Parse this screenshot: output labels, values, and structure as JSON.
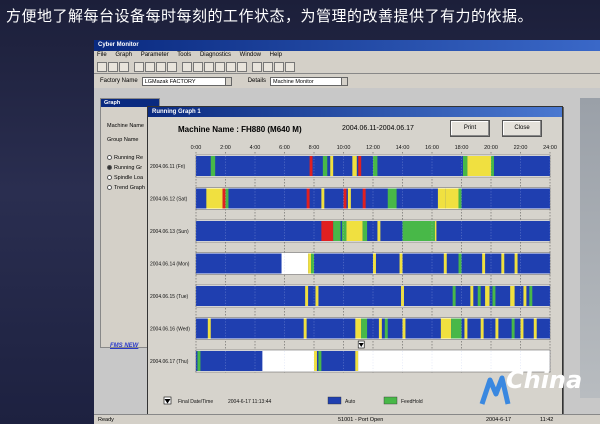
{
  "slide": {
    "title": "方便地了解每台设备每时每刻的工作状态，为管理的改善提供了有力的依据。"
  },
  "app": {
    "window_title": "Cyber Monitor",
    "menu": [
      "File",
      "Graph",
      "Parameter",
      "Tools",
      "Diagnostics",
      "Window",
      "Help"
    ],
    "factory_label": "Factory Name",
    "factory_value": "LGMazak FACTORY",
    "details_label": "Details",
    "details_value": "Machine Monitor"
  },
  "graph_panel": {
    "title": "Graph",
    "machine_name_label": "Machine Name",
    "group_name_label": "Group Name",
    "options": [
      "Running Re",
      "Running Gr",
      "Spindle Loa",
      "Trend Graph"
    ],
    "link": "FMS NEW"
  },
  "dialog": {
    "title": "Running Graph 1",
    "machine_label": "Machine Name :",
    "machine_value": "FH880 (M640 M)",
    "date_range": "2004.06.11-2004.06.17",
    "print_label": "Print",
    "close_label": "Close"
  },
  "statusbar": {
    "ready": "Ready",
    "port": "51001 - Port Open",
    "date": "2004-6-17",
    "time": "11:42"
  },
  "logo": {
    "text": "China"
  },
  "colors": {
    "auto": "#1f3fb0",
    "feedhold": "#48b848",
    "warning": "#f0e040",
    "alarm": "#e02020",
    "stop": "#ffffff",
    "row_bg": "#1f3fb0"
  },
  "chart_data": {
    "type": "gantt",
    "title": "",
    "x_ticks": [
      "0:00",
      "2:00",
      "4:00",
      "6:00",
      "8:00",
      "10:00",
      "12:00",
      "14:00",
      "16:00",
      "18:00",
      "20:00",
      "22:00",
      "24:00"
    ],
    "xlim_hours": [
      0,
      24
    ],
    "rows": [
      {
        "label": "2004.06.11 (Fri)",
        "segments": [
          {
            "start": 0,
            "end": 24,
            "state": "auto"
          },
          {
            "start": 1.0,
            "end": 1.3,
            "state": "feedhold"
          },
          {
            "start": 7.7,
            "end": 7.9,
            "state": "alarm"
          },
          {
            "start": 8.6,
            "end": 8.9,
            "state": "feedhold"
          },
          {
            "start": 9.1,
            "end": 9.3,
            "state": "warning"
          },
          {
            "start": 10.6,
            "end": 10.9,
            "state": "warning"
          },
          {
            "start": 11.0,
            "end": 11.2,
            "state": "alarm"
          },
          {
            "start": 12.0,
            "end": 12.3,
            "state": "feedhold"
          },
          {
            "start": 18.1,
            "end": 18.4,
            "state": "feedhold"
          },
          {
            "start": 18.4,
            "end": 20.0,
            "state": "warning"
          },
          {
            "start": 20.0,
            "end": 20.2,
            "state": "feedhold"
          }
        ]
      },
      {
        "label": "2004.06.12 (Sat)",
        "segments": [
          {
            "start": 0,
            "end": 24,
            "state": "auto"
          },
          {
            "start": 0.7,
            "end": 1.8,
            "state": "warning"
          },
          {
            "start": 1.8,
            "end": 2.0,
            "state": "alarm"
          },
          {
            "start": 2.0,
            "end": 2.2,
            "state": "feedhold"
          },
          {
            "start": 7.5,
            "end": 7.7,
            "state": "alarm"
          },
          {
            "start": 8.5,
            "end": 8.7,
            "state": "warning"
          },
          {
            "start": 10.0,
            "end": 10.2,
            "state": "alarm"
          },
          {
            "start": 10.3,
            "end": 10.5,
            "state": "warning"
          },
          {
            "start": 11.3,
            "end": 11.5,
            "state": "alarm"
          },
          {
            "start": 13.0,
            "end": 13.6,
            "state": "feedhold"
          },
          {
            "start": 16.4,
            "end": 16.9,
            "state": "warning"
          },
          {
            "start": 16.9,
            "end": 17.8,
            "state": "warning"
          },
          {
            "start": 17.8,
            "end": 18.0,
            "state": "feedhold"
          }
        ]
      },
      {
        "label": "2004.06.13 (Sun)",
        "segments": [
          {
            "start": 0,
            "end": 24,
            "state": "auto"
          },
          {
            "start": 8.5,
            "end": 9.3,
            "state": "alarm"
          },
          {
            "start": 9.3,
            "end": 9.8,
            "state": "feedhold"
          },
          {
            "start": 9.9,
            "end": 10.2,
            "state": "feedhold"
          },
          {
            "start": 10.2,
            "end": 11.3,
            "state": "warning"
          },
          {
            "start": 11.3,
            "end": 11.6,
            "state": "feedhold"
          },
          {
            "start": 12.3,
            "end": 12.5,
            "state": "warning"
          },
          {
            "start": 14.0,
            "end": 16.2,
            "state": "feedhold"
          },
          {
            "start": 16.2,
            "end": 16.3,
            "state": "warning"
          }
        ]
      },
      {
        "label": "2004.06.14 (Mon)",
        "segments": [
          {
            "start": 0,
            "end": 24,
            "state": "auto"
          },
          {
            "start": 5.8,
            "end": 7.6,
            "state": "stop"
          },
          {
            "start": 7.6,
            "end": 7.8,
            "state": "warning"
          },
          {
            "start": 7.8,
            "end": 8.0,
            "state": "feedhold"
          },
          {
            "start": 12.0,
            "end": 12.2,
            "state": "warning"
          },
          {
            "start": 13.8,
            "end": 14.0,
            "state": "warning"
          },
          {
            "start": 16.8,
            "end": 17.0,
            "state": "warning"
          },
          {
            "start": 17.8,
            "end": 18.0,
            "state": "feedhold"
          },
          {
            "start": 19.4,
            "end": 19.6,
            "state": "warning"
          },
          {
            "start": 20.7,
            "end": 20.9,
            "state": "warning"
          },
          {
            "start": 21.6,
            "end": 21.8,
            "state": "warning"
          }
        ]
      },
      {
        "label": "2004.06.15 (Tue)",
        "segments": [
          {
            "start": 0,
            "end": 24,
            "state": "auto"
          },
          {
            "start": 7.4,
            "end": 7.6,
            "state": "warning"
          },
          {
            "start": 8.1,
            "end": 8.3,
            "state": "warning"
          },
          {
            "start": 13.9,
            "end": 14.1,
            "state": "warning"
          },
          {
            "start": 17.4,
            "end": 17.6,
            "state": "feedhold"
          },
          {
            "start": 18.6,
            "end": 18.8,
            "state": "warning"
          },
          {
            "start": 19.1,
            "end": 19.3,
            "state": "feedhold"
          },
          {
            "start": 19.6,
            "end": 19.9,
            "state": "warning"
          },
          {
            "start": 20.1,
            "end": 20.3,
            "state": "feedhold"
          },
          {
            "start": 21.3,
            "end": 21.6,
            "state": "warning"
          },
          {
            "start": 22.2,
            "end": 22.4,
            "state": "warning"
          },
          {
            "start": 22.6,
            "end": 22.8,
            "state": "feedhold"
          }
        ]
      },
      {
        "label": "2004.06.16 (Wed)",
        "segments": [
          {
            "start": 0,
            "end": 24,
            "state": "auto"
          },
          {
            "start": 0.8,
            "end": 1.0,
            "state": "warning"
          },
          {
            "start": 7.3,
            "end": 7.5,
            "state": "warning"
          },
          {
            "start": 10.8,
            "end": 11.2,
            "state": "warning"
          },
          {
            "start": 11.2,
            "end": 11.6,
            "state": "feedhold"
          },
          {
            "start": 12.4,
            "end": 12.6,
            "state": "warning"
          },
          {
            "start": 12.8,
            "end": 13.0,
            "state": "feedhold"
          },
          {
            "start": 14.0,
            "end": 14.2,
            "state": "warning"
          },
          {
            "start": 16.6,
            "end": 17.3,
            "state": "warning"
          },
          {
            "start": 17.3,
            "end": 18.0,
            "state": "feedhold"
          },
          {
            "start": 18.2,
            "end": 18.4,
            "state": "warning"
          },
          {
            "start": 19.3,
            "end": 19.5,
            "state": "warning"
          },
          {
            "start": 20.3,
            "end": 20.5,
            "state": "warning"
          },
          {
            "start": 21.4,
            "end": 21.6,
            "state": "feedhold"
          },
          {
            "start": 22.0,
            "end": 22.2,
            "state": "warning"
          },
          {
            "start": 22.9,
            "end": 23.1,
            "state": "warning"
          }
        ]
      },
      {
        "label": "2004.06.17 (Thu)",
        "segments": [
          {
            "start": 0,
            "end": 11.0,
            "state": "auto"
          },
          {
            "start": 0.1,
            "end": 0.3,
            "state": "feedhold"
          },
          {
            "start": 4.5,
            "end": 8.0,
            "state": "stop"
          },
          {
            "start": 8.0,
            "end": 8.2,
            "state": "warning"
          },
          {
            "start": 8.3,
            "end": 8.5,
            "state": "feedhold"
          },
          {
            "start": 10.8,
            "end": 11.0,
            "state": "warning"
          },
          {
            "start": 11.0,
            "end": 11.7,
            "state": "stop"
          }
        ]
      }
    ],
    "final_marker_hours": 11.2,
    "legend": [
      {
        "label": "Final Date/Time",
        "value": "2004-6-17 11:13:44"
      },
      {
        "label": "Auto",
        "state": "auto"
      },
      {
        "label": "FeedHold",
        "state": "feedhold"
      }
    ]
  }
}
